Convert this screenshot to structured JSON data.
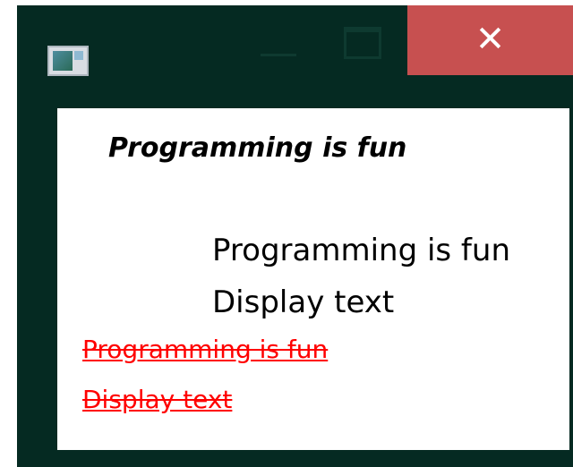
{
  "window": {
    "icons": {
      "app": "application-icon",
      "minimize": "minimize-icon",
      "maximize": "maximize-icon",
      "close": "close-icon"
    },
    "close_glyph": "✕",
    "colors": {
      "frame": "#052a22",
      "close_button": "#c75050",
      "client_background": "#ffffff",
      "red_text": "#ff0000"
    }
  },
  "content": {
    "bold_italic_label": "Programming is fun",
    "plain_label_1": "Programming is fun",
    "plain_label_2": "Display text",
    "red_label_1": "Programming is fun",
    "red_label_2": "Display text"
  }
}
